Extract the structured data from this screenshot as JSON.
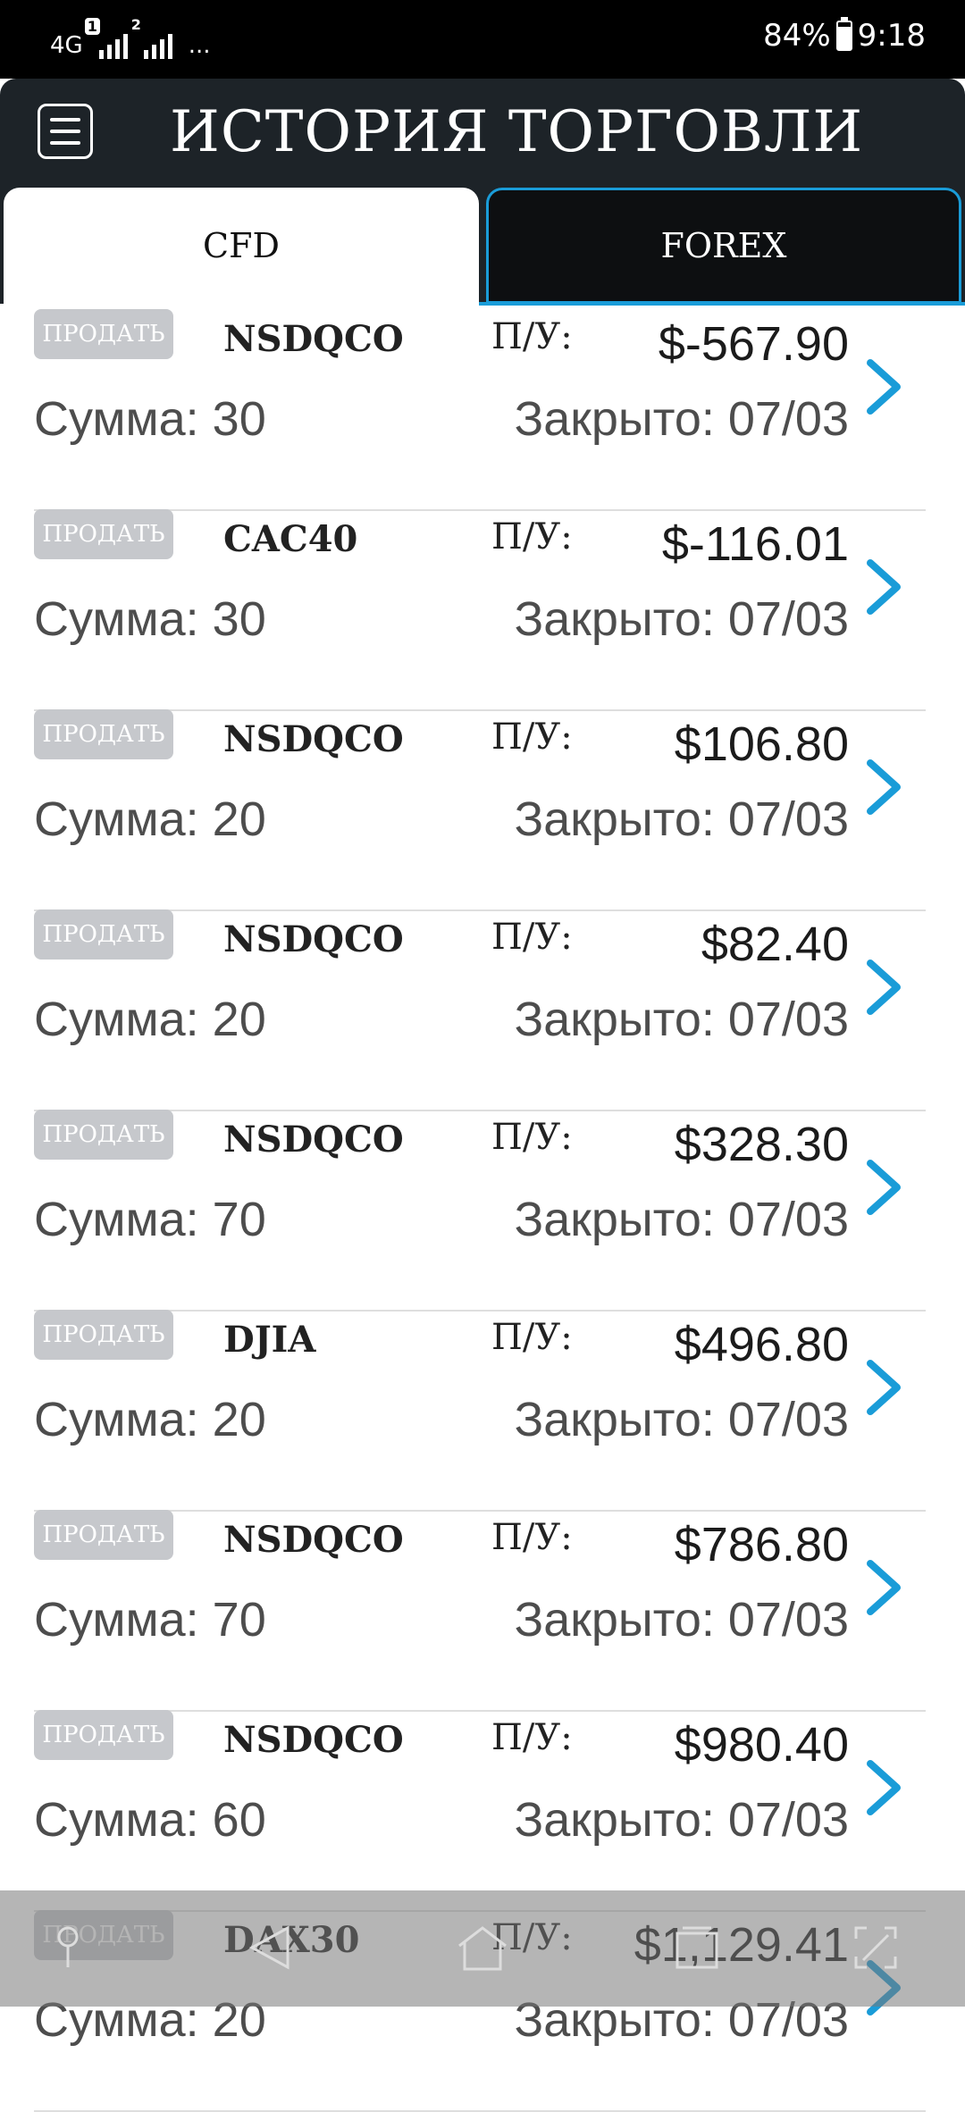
{
  "status_bar": {
    "network": "4G",
    "sim1_badge": "1",
    "sim2_badge": "2",
    "more": "...",
    "battery": "84%",
    "time": "9:18",
    "battery_level": 0.84
  },
  "header": {
    "title": "ИСТОРИЯ ТОРГОВЛИ",
    "menu_icon": "hamburger-menu-icon"
  },
  "tabs": [
    {
      "label": "CFD",
      "active": true
    },
    {
      "label": "FOREX",
      "active": false
    }
  ],
  "colors": {
    "header_bg": "#1d2328",
    "accent": "#1a9cd8",
    "badge_bg": "#c6c8cc"
  },
  "trades": [
    {
      "side": "ПРОДАТЬ",
      "symbol": "NSDQCO",
      "pl_label": "П/У:",
      "pl": "$-567.90",
      "amount": "Сумма: 30",
      "closed": "Закрыто: 07/03"
    },
    {
      "side": "ПРОДАТЬ",
      "symbol": "CAC40",
      "pl_label": "П/У:",
      "pl": "$-116.01",
      "amount": "Сумма: 30",
      "closed": "Закрыто: 07/03"
    },
    {
      "side": "ПРОДАТЬ",
      "symbol": "NSDQCO",
      "pl_label": "П/У:",
      "pl": "$106.80",
      "amount": "Сумма: 20",
      "closed": "Закрыто: 07/03"
    },
    {
      "side": "ПРОДАТЬ",
      "symbol": "NSDQCO",
      "pl_label": "П/У:",
      "pl": "$82.40",
      "amount": "Сумма: 20",
      "closed": "Закрыто: 07/03"
    },
    {
      "side": "ПРОДАТЬ",
      "symbol": "NSDQCO",
      "pl_label": "П/У:",
      "pl": "$328.30",
      "amount": "Сумма: 70",
      "closed": "Закрыто: 07/03"
    },
    {
      "side": "ПРОДАТЬ",
      "symbol": "DJIA",
      "pl_label": "П/У:",
      "pl": "$496.80",
      "amount": "Сумма: 20",
      "closed": "Закрыто: 07/03"
    },
    {
      "side": "ПРОДАТЬ",
      "symbol": "NSDQCO",
      "pl_label": "П/У:",
      "pl": "$786.80",
      "amount": "Сумма: 70",
      "closed": "Закрыто: 07/03"
    },
    {
      "side": "ПРОДАТЬ",
      "symbol": "NSDQCO",
      "pl_label": "П/У:",
      "pl": "$980.40",
      "amount": "Сумма: 60",
      "closed": "Закрыто: 07/03"
    },
    {
      "side": "ПРОДАТЬ",
      "symbol": "DAX30",
      "pl_label": "П/У:",
      "pl": "$1,129.41",
      "amount": "Сумма: 20",
      "closed": "Закрыто: 07/03"
    }
  ],
  "nav_bar": {
    "icons": [
      "pin-icon",
      "back-icon",
      "home-icon",
      "recents-icon",
      "screenshot-icon"
    ]
  }
}
